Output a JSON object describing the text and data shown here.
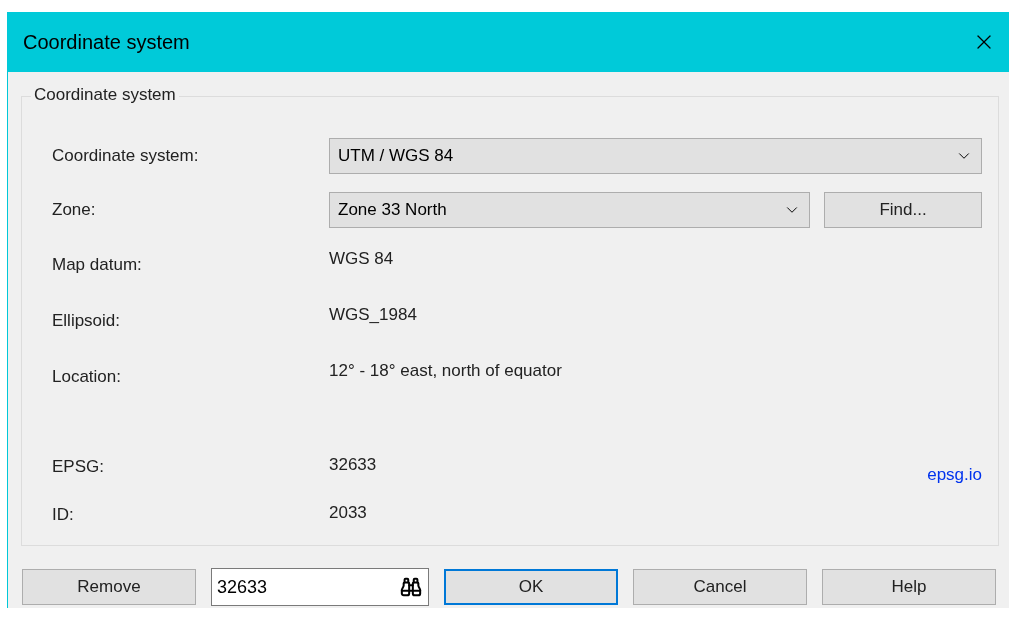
{
  "window": {
    "title": "Coordinate system"
  },
  "group": {
    "title": "Coordinate system",
    "fields": [
      {
        "kind": "select",
        "label": "Coordinate system:",
        "value": "UTM / WGS 84"
      },
      {
        "kind": "select",
        "label": "Zone:",
        "value": "Zone 33 North",
        "button": "Find..."
      },
      {
        "kind": "text",
        "label": "Map datum:",
        "value": "WGS 84"
      },
      {
        "kind": "text",
        "label": "Ellipsoid:",
        "value": "WGS_1984"
      },
      {
        "kind": "text",
        "label": "Location:",
        "value": "12° - 18° east, north of equator"
      }
    ],
    "identifiers": [
      {
        "label": "EPSG:",
        "value": "32633",
        "link": "epsg.io"
      },
      {
        "label": "ID:",
        "value": "2033"
      }
    ]
  },
  "footer": {
    "remove": "Remove",
    "search_value": "32633",
    "buttons": [
      {
        "label": "OK",
        "default": true
      },
      {
        "label": "Cancel",
        "default": false
      },
      {
        "label": "Help",
        "default": false
      }
    ]
  }
}
